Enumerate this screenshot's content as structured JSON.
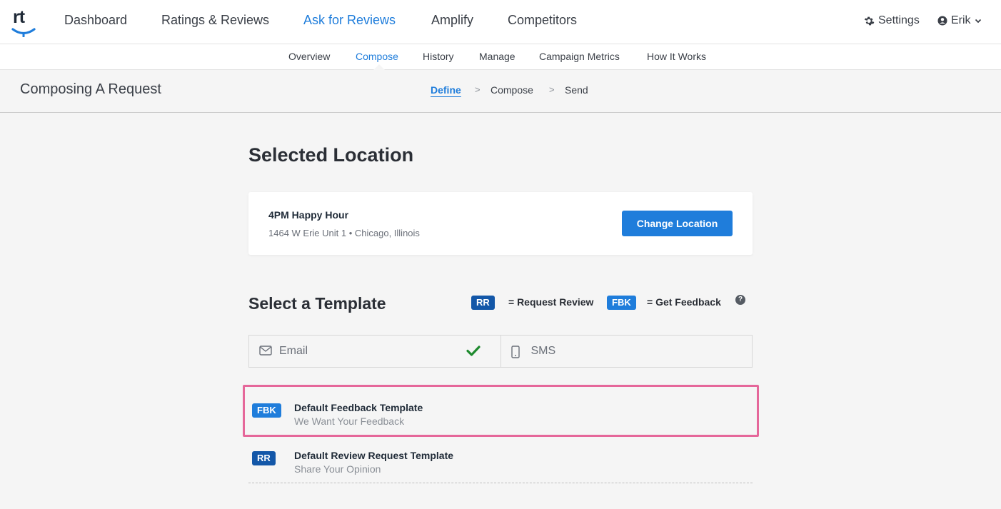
{
  "nav": {
    "logo_text": "rt",
    "items": [
      {
        "label": "Dashboard"
      },
      {
        "label": "Ratings & Reviews"
      },
      {
        "label": "Ask for Reviews",
        "active": true
      },
      {
        "label": "Amplify"
      },
      {
        "label": "Competitors"
      }
    ],
    "settings_label": "Settings",
    "user_label": "Erik",
    "accent_color": "#1f7ddb"
  },
  "subnav": {
    "items": [
      {
        "label": "Overview"
      },
      {
        "label": "Compose",
        "active": true
      },
      {
        "label": "History"
      },
      {
        "label": "Manage"
      },
      {
        "label": "Campaign Metrics"
      },
      {
        "label": "How It Works"
      }
    ]
  },
  "header": {
    "title": "Composing A Request",
    "steps": [
      {
        "label": "Define",
        "active": true
      },
      {
        "label": "Compose"
      },
      {
        "label": "Send"
      }
    ],
    "separator": ">"
  },
  "location": {
    "heading": "Selected Location",
    "name": "4PM Happy Hour",
    "address": "1464 W Erie Unit 1 • Chicago, Illinois",
    "change_button": "Change Location"
  },
  "templates": {
    "heading": "Select a Template",
    "legend": [
      {
        "badge": "RR",
        "text": "= Request Review"
      },
      {
        "badge": "FBK",
        "text": "= Get Feedback"
      }
    ],
    "help_icon": "?",
    "tabs": [
      {
        "label": "Email",
        "icon": "envelope-icon",
        "selected": true
      },
      {
        "label": "SMS",
        "icon": "mobile-icon",
        "selected": false
      }
    ],
    "list": [
      {
        "badge": "FBK",
        "name": "Default Feedback Template",
        "subject": "We Want Your Feedback",
        "highlighted": true
      },
      {
        "badge": "RR",
        "name": "Default Review Request Template",
        "subject": "Share Your Opinion",
        "highlighted": false
      }
    ],
    "highlight_color": "#e5679a",
    "check_color": "#1e8a2e"
  }
}
